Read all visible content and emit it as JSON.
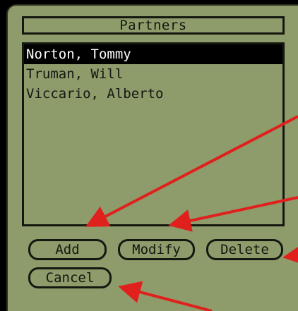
{
  "dialog": {
    "title": "Partners",
    "items": [
      {
        "label": "Norton, Tommy",
        "selected": true
      },
      {
        "label": "Truman, Will",
        "selected": false
      },
      {
        "label": "Viccario, Alberto",
        "selected": false
      }
    ]
  },
  "buttons": {
    "add": "Add",
    "modify": "Modify",
    "delete": "Delete",
    "cancel": "Cancel"
  },
  "colors": {
    "screen_background": "#8e9b6b",
    "text": "#151810",
    "selection": "#000000",
    "annotation_arrows": "#e0201c"
  }
}
